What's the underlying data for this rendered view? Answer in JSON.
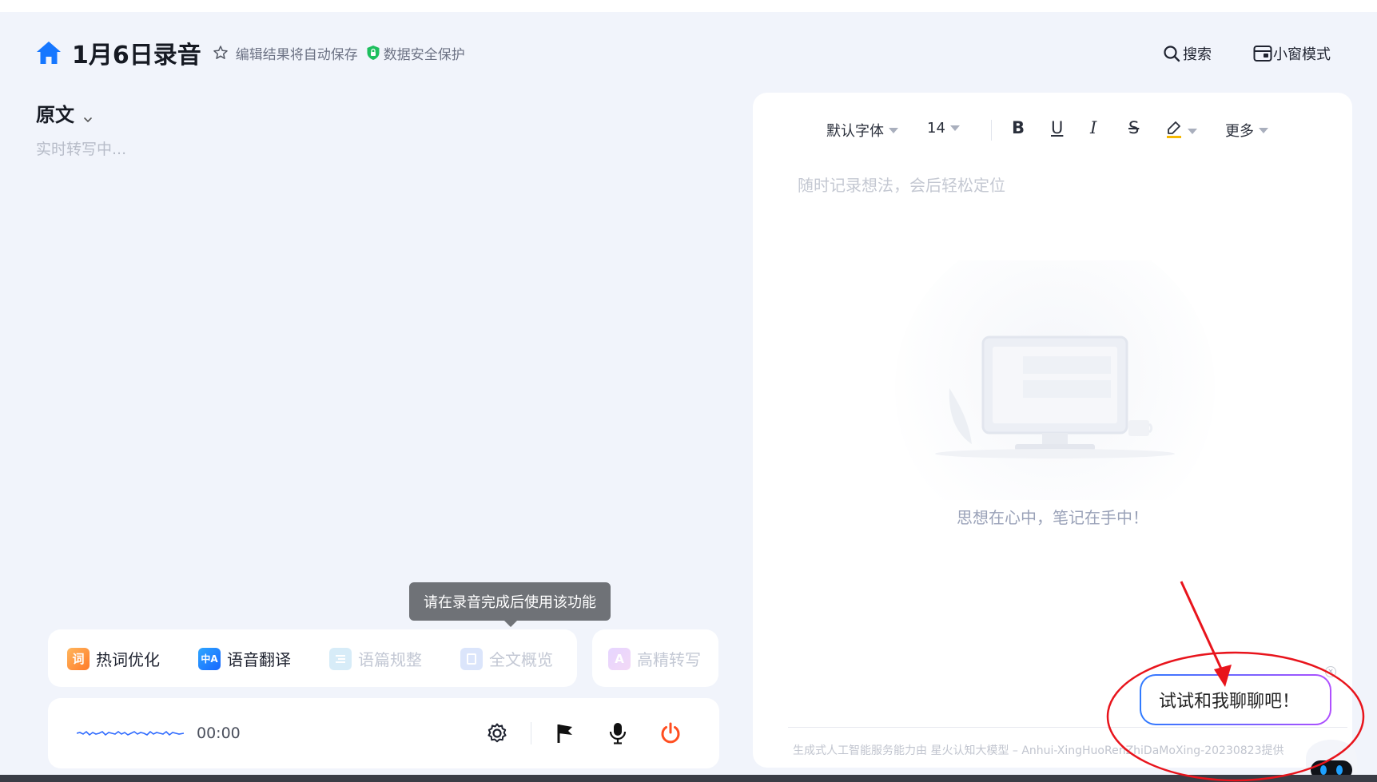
{
  "header": {
    "title": "1月6日录音",
    "autosave_text": "编辑结果将自动保存",
    "security_text": "数据安全保护",
    "search_label": "搜索",
    "small_window_label": "小窗模式"
  },
  "left_panel": {
    "section_label": "原文",
    "status_text": "实时转写中..."
  },
  "tooltip": {
    "text": "请在录音完成后使用该功能"
  },
  "features": [
    {
      "label": "热词优化",
      "icon_text": "词",
      "enabled": true
    },
    {
      "label": "语音翻译",
      "icon_text": "中A",
      "enabled": true
    },
    {
      "label": "语篇规整",
      "icon_text": "",
      "enabled": false
    },
    {
      "label": "全文概览",
      "icon_text": "",
      "enabled": false
    },
    {
      "label": "高精转写",
      "icon_text": "A",
      "enabled": false
    }
  ],
  "record_bar": {
    "timer": "00:00"
  },
  "toolbar": {
    "font_family": "默认字体",
    "font_size": "14",
    "bold": "B",
    "underline": "U",
    "italic": "I",
    "strike": "S",
    "more": "更多"
  },
  "notes": {
    "placeholder": "随时记录想法，会后轻松定位",
    "empty_text": "思想在心中，笔记在手中！",
    "footer": "生成式人工智能服务能力由 星火认知大模型 – Anhui-XingHuoRenZhiDaMoXing-20230823提供"
  },
  "chat": {
    "bubble_text": "试试和我聊聊吧！",
    "close": "×"
  },
  "colors": {
    "accent_blue": "#1677ff",
    "record_red": "#ff4d1f",
    "annotation_red": "#e8141c"
  }
}
